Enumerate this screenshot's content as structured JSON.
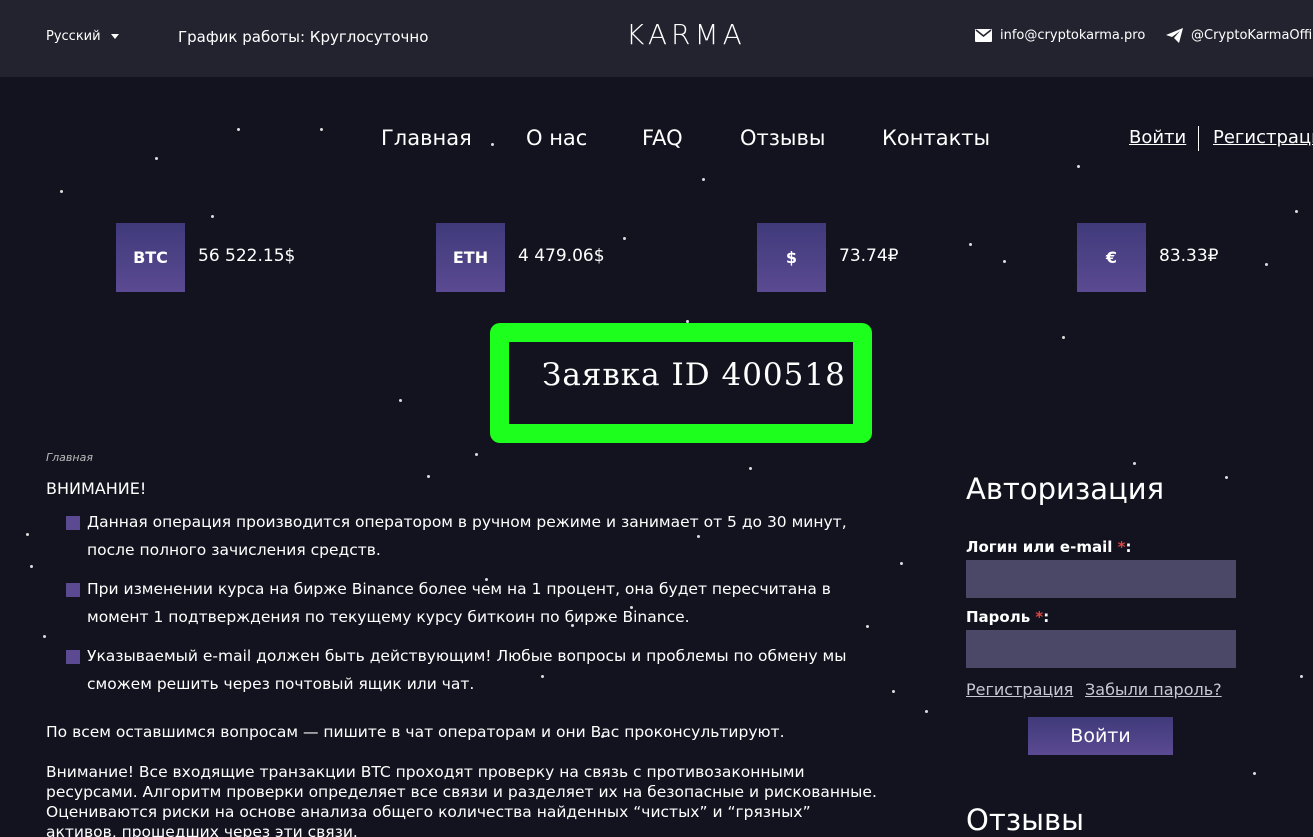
{
  "topbar": {
    "language": "Русский",
    "hours": "График работы: Круглосуточно",
    "logo": "KARMA",
    "email": "info@cryptokarma.pro",
    "telegram": "@CryptoKarmaOffic"
  },
  "nav": {
    "items": [
      "Главная",
      "О нас",
      "FAQ",
      "Отзывы",
      "Контакты"
    ],
    "login": "Войти",
    "register": "Регистраци"
  },
  "rates": [
    {
      "label": "BTC",
      "value": "56 522.15$"
    },
    {
      "label": "ETH",
      "value": "4 479.06$"
    },
    {
      "label": "$",
      "value": "73.74₽"
    },
    {
      "label": "€",
      "value": "83.33₽"
    }
  ],
  "page_title": "Заявка ID 400518",
  "breadcrumb": "Главная",
  "attention": "ВНИМАНИЕ!",
  "bullets": [
    "Данная операция производится оператором в ручном режиме и занимает от 5 до 30 минут, после полного зачисления средств.",
    "При изменении курса на бирже Binance более чем на 1 процент, она будет пересчитана в момент 1 подтверждения по текущему курсу биткоин по бирже Binance.",
    "Указываемый e-mail должен быть действующим! Любые вопросы и проблемы по обмену мы сможем решить через почтовый ящик или чат."
  ],
  "para1": "По всем оставшимся вопросам — пишите в чат операторам и они Вас проконсультируют.",
  "para2": "Внимание! Все входящие транзакции BTC проходят проверку на связь с противозаконными ресурсами. Алгоритм проверки определяет все связи и разделяет их на безопасные и рискованные. Оцениваются риски на основе анализа общего количества найденных “чистых” и “грязных” активов, прошедших через эти связи.",
  "sidebar": {
    "title": "Авторизация",
    "login_label": "Логин или e-mail ",
    "password_label": "Пароль ",
    "required_mark": "*",
    "register_link": "Регистрация",
    "forgot_link": "Забыли пароль?",
    "login_button": "Войти",
    "reviews_title": "Отзывы"
  },
  "colors": {
    "background": "#13131f",
    "topbar": "#23232f",
    "accent": "#5b4a92",
    "highlight": "#1dff1d"
  }
}
